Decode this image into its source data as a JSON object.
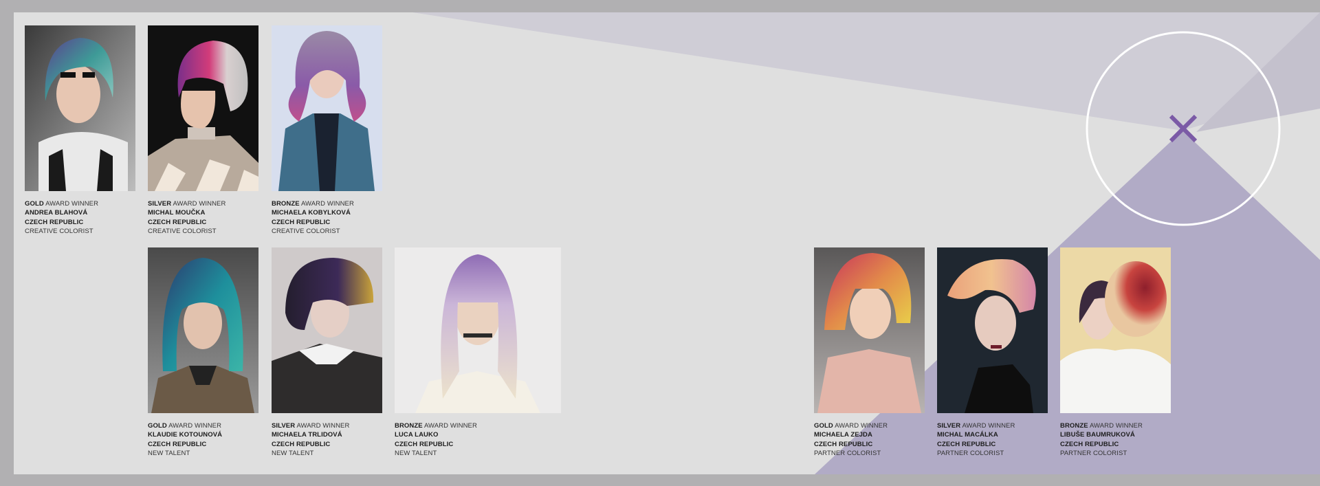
{
  "colors": {
    "page_bg": "#dfdfdf",
    "frame": "#b1b0b2",
    "light_lilac": "#cfcdd6",
    "lilac": "#b1abc6",
    "accent_purple": "#7b5aa6",
    "ring": "#ffffff"
  },
  "logo": {
    "icon": "x-mark-in-ring-icon"
  },
  "rows": {
    "creative_colorist": [
      {
        "medal": "GOLD",
        "award": "AWARD WINNER",
        "name": "ANDREA BLAHOVÁ",
        "country": "CZECH REPUBLIC",
        "category": "CREATIVE COLORIST",
        "portrait": "teal-purple-bob-with-black-harness"
      },
      {
        "medal": "SILVER",
        "award": "AWARD WINNER",
        "name": "MICHAL MOUČKA",
        "country": "CZECH REPUBLIC",
        "category": "CREATIVE COLORIST",
        "portrait": "profile-pink-purple-bob-mirror-collar"
      },
      {
        "medal": "BRONZE",
        "award": "AWARD WINNER",
        "name": "MICHAELA KOBYLKOVÁ",
        "country": "CZECH REPUBLIC",
        "category": "CREATIVE COLORIST",
        "portrait": "lavender-waves-teal-vest"
      }
    ],
    "new_talent": [
      {
        "medal": "GOLD",
        "award": "AWARD WINNER",
        "name": "KLAUDIE KOTOUNOVÁ",
        "country": "CZECH REPUBLIC",
        "category": "NEW TALENT",
        "portrait": "teal-blue-long-bob"
      },
      {
        "medal": "SILVER",
        "award": "AWARD WINNER",
        "name": "MICHAELA TRLIDOVÁ",
        "country": "CZECH REPUBLIC",
        "category": "NEW TALENT",
        "portrait": "dark-bowl-cut-gold-streak"
      },
      {
        "medal": "BRONZE",
        "award": "AWARD WINNER",
        "name": "LUCA LAUKO",
        "country": "CZECH REPUBLIC",
        "category": "NEW TALENT",
        "portrait": "blonde-with-purple-fringe"
      }
    ],
    "partner_colorist": [
      {
        "medal": "GOLD",
        "award": "AWARD WINNER",
        "name": "MICHAELA ZEJDA",
        "country": "CZECH REPUBLIC",
        "category": "PARTNER COLORIST",
        "portrait": "sunset-bob-pink-yellow"
      },
      {
        "medal": "SILVER",
        "award": "AWARD WINNER",
        "name": "MICHAL MACÁLKA",
        "country": "CZECH REPUBLIC",
        "category": "PARTNER COLORIST",
        "portrait": "peach-quiff-dark-background"
      },
      {
        "medal": "BRONZE",
        "award": "AWARD WINNER",
        "name": "LIBUŠE BAUMRUKOVÁ",
        "country": "CZECH REPUBLIC",
        "category": "PARTNER COLORIST",
        "portrait": "red-teased-updo-white-ruffles"
      }
    ]
  }
}
